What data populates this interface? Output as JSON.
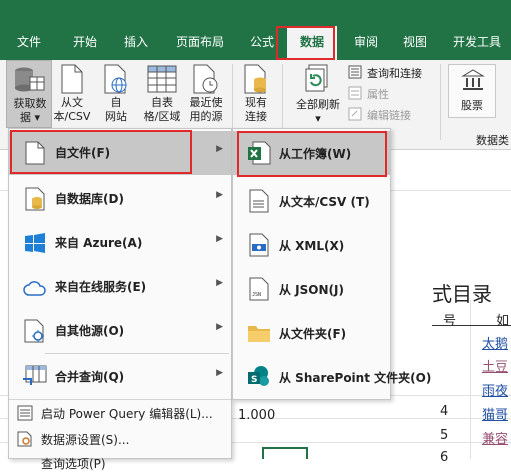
{
  "tabs": [
    "文件",
    "开始",
    "插入",
    "页面布局",
    "公式",
    "数据",
    "审阅",
    "视图",
    "开发工具"
  ],
  "ribbon": {
    "get_data": [
      "获取数",
      "据"
    ],
    "get_data_arrow": "▾",
    "from_text": [
      "从文",
      "本/CSV"
    ],
    "from_web": [
      "自",
      "网站"
    ],
    "from_table": [
      "自表",
      "格/区域"
    ],
    "recent_sources": [
      "最近使",
      "用的源"
    ],
    "existing": [
      "现有",
      "连接"
    ],
    "refresh_all": "全部刷新",
    "refresh_arrow": "▾",
    "queries_connections": "查询和连接",
    "properties": "属性",
    "edit_links": "编辑链接",
    "stocks": "股票",
    "data_types_group": "数据类"
  },
  "menu_primary": [
    {
      "label": "自文件(F)",
      "has_sub": true
    },
    {
      "label": "自数据库(D)",
      "has_sub": true
    },
    {
      "label": "来自 Azure(A)",
      "has_sub": true
    },
    {
      "label": "来自在线服务(E)",
      "has_sub": true
    },
    {
      "label": "自其他源(O)",
      "has_sub": true
    },
    {
      "label": "合并查询(Q)",
      "has_sub": true
    }
  ],
  "menu_primary_small": [
    "启动 Power Query 编辑器(L)...",
    "数据源设置(S)...",
    "查询选项(P)"
  ],
  "menu_file": [
    {
      "label": "从工作簿(W)"
    },
    {
      "label": "从文本/CSV (T)"
    },
    {
      "label": "从 XML(X)"
    },
    {
      "label": "从 JSON(J)"
    },
    {
      "label": "从文件夹(F)"
    },
    {
      "label": "从 SharePoint 文件夹(O)"
    }
  ],
  "sheet": {
    "title_partial": "式目录",
    "header_num": "号",
    "header_b": "如",
    "cell_1000": "1.000",
    "rows": [
      {
        "num": "",
        "name": "太鹅"
      },
      {
        "num": "",
        "name": "土豆"
      },
      {
        "num": "",
        "name": "雨夜"
      },
      {
        "num": "4",
        "name": "猫哥"
      },
      {
        "num": "5",
        "name": "兼容"
      },
      {
        "num": "6",
        "name": ""
      }
    ]
  },
  "colors": {
    "excel_green": "#217346",
    "highlight_red": "#e02a2a",
    "menu_selected": "#c7c7c7"
  }
}
